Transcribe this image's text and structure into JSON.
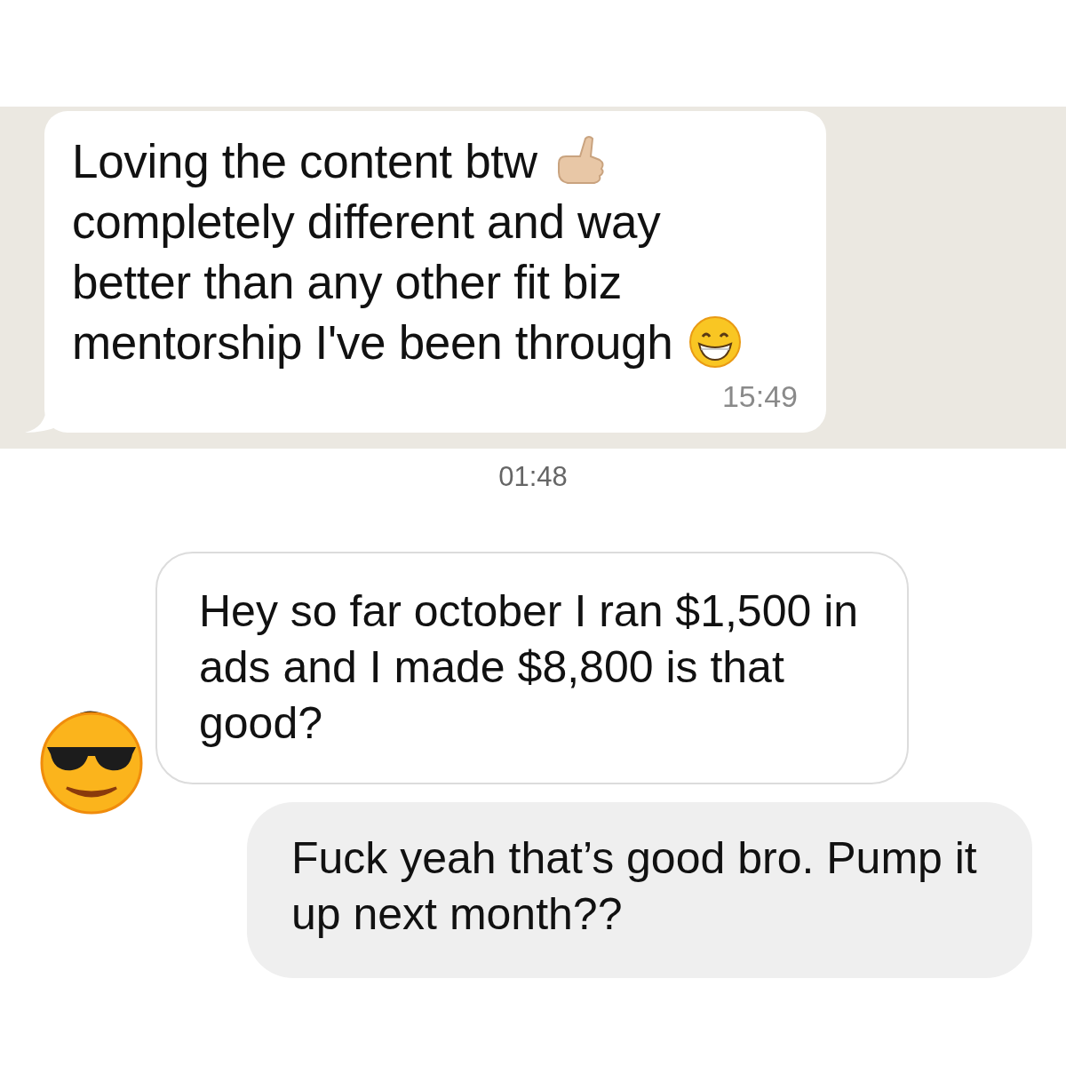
{
  "whatsapp_message": {
    "lines": [
      {
        "text": "Loving the content btw",
        "kind": "hand-emoji"
      },
      {
        "text": "completely different and way",
        "kind": "plain"
      },
      {
        "text": "better than any other fit biz",
        "kind": "plain"
      },
      {
        "text": "mentorship I've been through",
        "kind": "grin-emoji"
      }
    ],
    "time": "15:49"
  },
  "instagram_chat": {
    "timestamp": "01:48",
    "messages": [
      {
        "kind": "incoming",
        "text": "Hey so far october I ran $1,500 in ads and I made $8,800 is that good?"
      },
      {
        "kind": "outgoing",
        "text": "Fuck yeah that’s good bro. Pump it up next month??"
      }
    ]
  }
}
